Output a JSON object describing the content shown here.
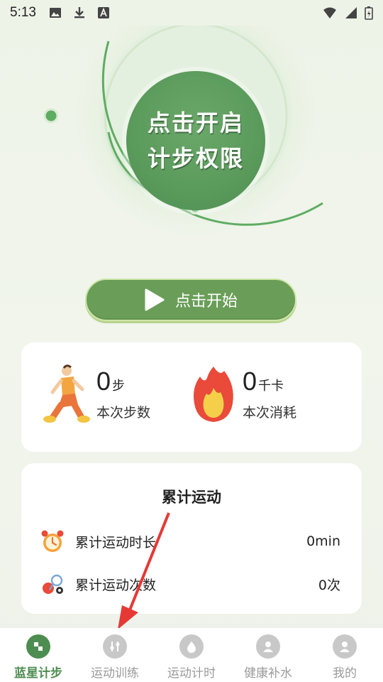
{
  "status_bar": {
    "time": "5:13"
  },
  "ring": {
    "center_line1": "点击开启",
    "center_line2": "计步权限"
  },
  "start_button": {
    "label": "点击开始"
  },
  "stats": {
    "steps": {
      "value": "0",
      "unit": "步",
      "label": "本次步数"
    },
    "calories": {
      "value": "0",
      "unit": "千卡",
      "label": "本次消耗"
    }
  },
  "totals": {
    "title": "累计运动",
    "rows": [
      {
        "label": "累计运动时长",
        "value": "0min",
        "icon": "alarm-clock-icon"
      },
      {
        "label": "累计运动次数",
        "value": "0次",
        "icon": "sports-balls-icon"
      }
    ]
  },
  "bottom_nav": {
    "items": [
      {
        "label": "蓝星计步",
        "active": true,
        "icon": "steps-icon"
      },
      {
        "label": "运动训练",
        "active": false,
        "icon": "training-icon"
      },
      {
        "label": "运动计时",
        "active": false,
        "icon": "timer-icon"
      },
      {
        "label": "健康补水",
        "active": false,
        "icon": "person-icon"
      },
      {
        "label": "我的",
        "active": false,
        "icon": "profile-icon"
      }
    ]
  },
  "colors": {
    "primary_green": "#4e8d51",
    "button_green": "#6a9e58",
    "arrow_red": "#e53935"
  }
}
